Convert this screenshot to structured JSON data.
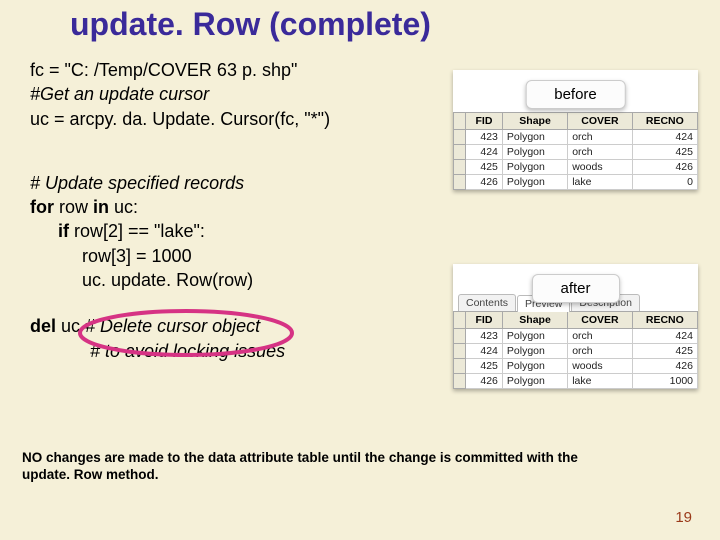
{
  "title": "update. Row (complete)",
  "code": {
    "l1": "fc = \"C: /Temp/COVER 63 p. shp\"",
    "l2": "#Get an update cursor",
    "l3": "uc = arcpy. da. Update. Cursor(fc, \"*\")",
    "l4": "# Update specified records",
    "l5a": "for",
    "l5b": " row ",
    "l5c": "in",
    "l5d": " uc:",
    "l6a": "if",
    "l6b": " row[2] == \"lake\":",
    "l7": "row[3] = 1000",
    "l8": "uc. update. Row(row)",
    "l9a": "del",
    "l9b": " uc ",
    "l9c": "# Delete cursor object",
    "l10": "# to avoid locking issues"
  },
  "footnote": "NO changes are made to the data attribute table until the change is committed with the update. Row method.",
  "pagenum": "19",
  "figBefore": {
    "label": "before",
    "headers": [
      "FID",
      "Shape",
      "COVER",
      "RECNO"
    ],
    "rows": [
      [
        "423",
        "Polygon",
        "orch",
        "424"
      ],
      [
        "424",
        "Polygon",
        "orch",
        "425"
      ],
      [
        "425",
        "Polygon",
        "woods",
        "426"
      ],
      [
        "426",
        "Polygon",
        "lake",
        "0"
      ]
    ]
  },
  "figAfter": {
    "label": "after",
    "tabs": [
      "Contents",
      "Preview",
      "Description"
    ],
    "headers": [
      "FID",
      "Shape",
      "COVER",
      "RECNO"
    ],
    "rows": [
      [
        "423",
        "Polygon",
        "orch",
        "424"
      ],
      [
        "424",
        "Polygon",
        "orch",
        "425"
      ],
      [
        "425",
        "Polygon",
        "woods",
        "426"
      ],
      [
        "426",
        "Polygon",
        "lake",
        "1000"
      ]
    ]
  }
}
